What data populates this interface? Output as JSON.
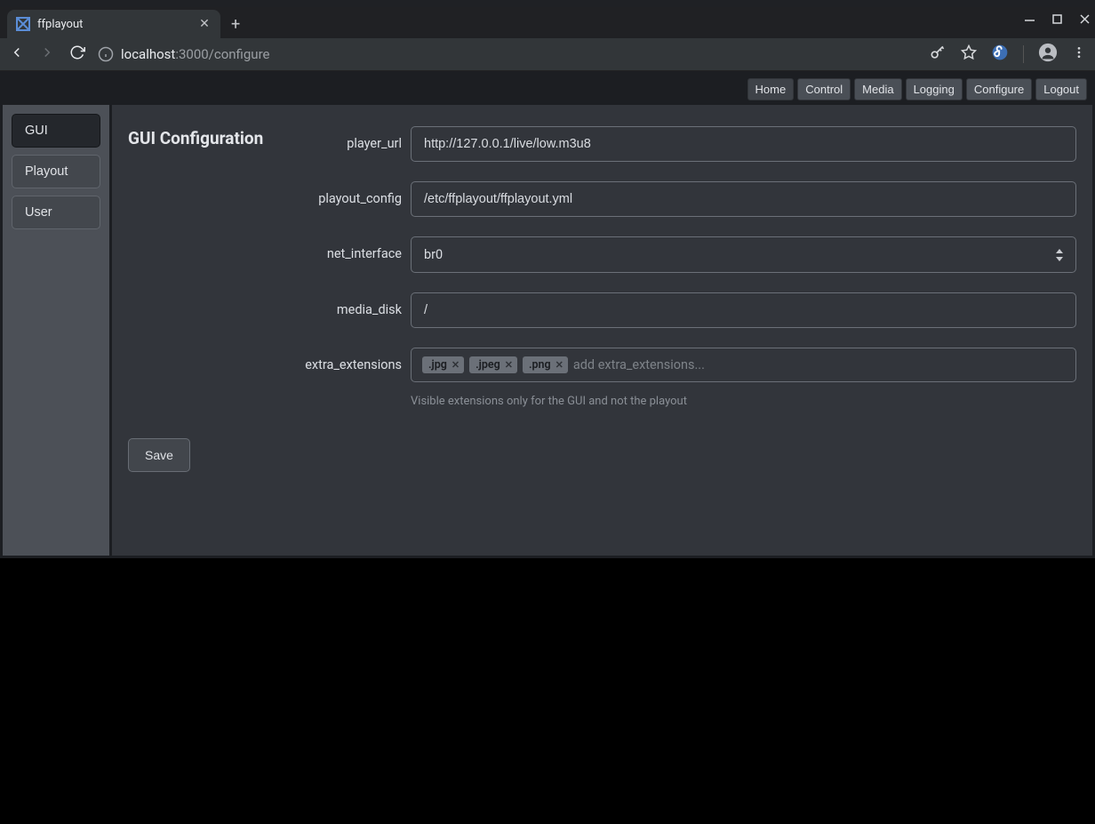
{
  "browser": {
    "tab_title": "ffplayout",
    "url_host": "localhost",
    "url_rest": ":3000/configure"
  },
  "topnav": {
    "items": [
      {
        "label": "Home"
      },
      {
        "label": "Control"
      },
      {
        "label": "Media"
      },
      {
        "label": "Logging"
      },
      {
        "label": "Configure"
      },
      {
        "label": "Logout"
      }
    ]
  },
  "sidebar": {
    "items": [
      {
        "label": "GUI"
      },
      {
        "label": "Playout"
      },
      {
        "label": "User"
      }
    ]
  },
  "form": {
    "title": "GUI Configuration",
    "player_url": {
      "label": "player_url",
      "value": "http://127.0.0.1/live/low.m3u8"
    },
    "playout_config": {
      "label": "playout_config",
      "value": "/etc/ffplayout/ffplayout.yml"
    },
    "net_interface": {
      "label": "net_interface",
      "value": "br0"
    },
    "media_disk": {
      "label": "media_disk",
      "value": "/"
    },
    "extra_extensions": {
      "label": "extra_extensions",
      "tags": [
        ".jpg",
        ".jpeg",
        ".png"
      ],
      "placeholder": "add extra_extensions...",
      "help": "Visible extensions only for the GUI and not the playout"
    },
    "save_label": "Save"
  }
}
